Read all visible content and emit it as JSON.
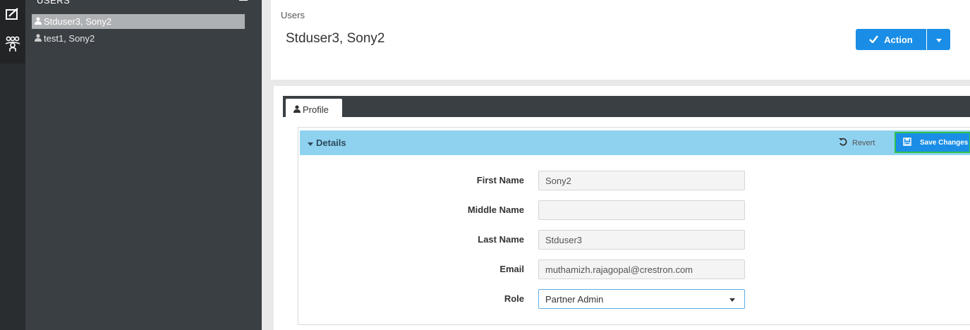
{
  "rail": {
    "icons": [
      "dashboard-icon",
      "users-group-icon"
    ]
  },
  "tree": {
    "header": "USERS",
    "items": [
      {
        "label": "Stduser3, Sony2",
        "selected": true
      },
      {
        "label": "test1, Sony2",
        "selected": false
      }
    ]
  },
  "header": {
    "breadcrumb": "Users",
    "title": "Stduser3, Sony2",
    "action_label": "Action"
  },
  "tabs": [
    {
      "label": "Profile"
    }
  ],
  "details": {
    "title": "Details",
    "revert_label": "Revert",
    "save_label": "Save Changes",
    "fields": [
      {
        "label": "First Name",
        "value": "Sony2"
      },
      {
        "label": "Middle Name",
        "value": ""
      },
      {
        "label": "Last Name",
        "value": "Stduser3"
      },
      {
        "label": "Email",
        "value": "muthamizh.rajagopal@crestron.com"
      },
      {
        "label": "Role",
        "value": "Partner Admin"
      }
    ]
  },
  "colors": {
    "accent": "#1a8ee6",
    "panel_header": "#8fd2f0",
    "sidebar": "#3a3f44",
    "highlight_border": "#2ec24d"
  }
}
